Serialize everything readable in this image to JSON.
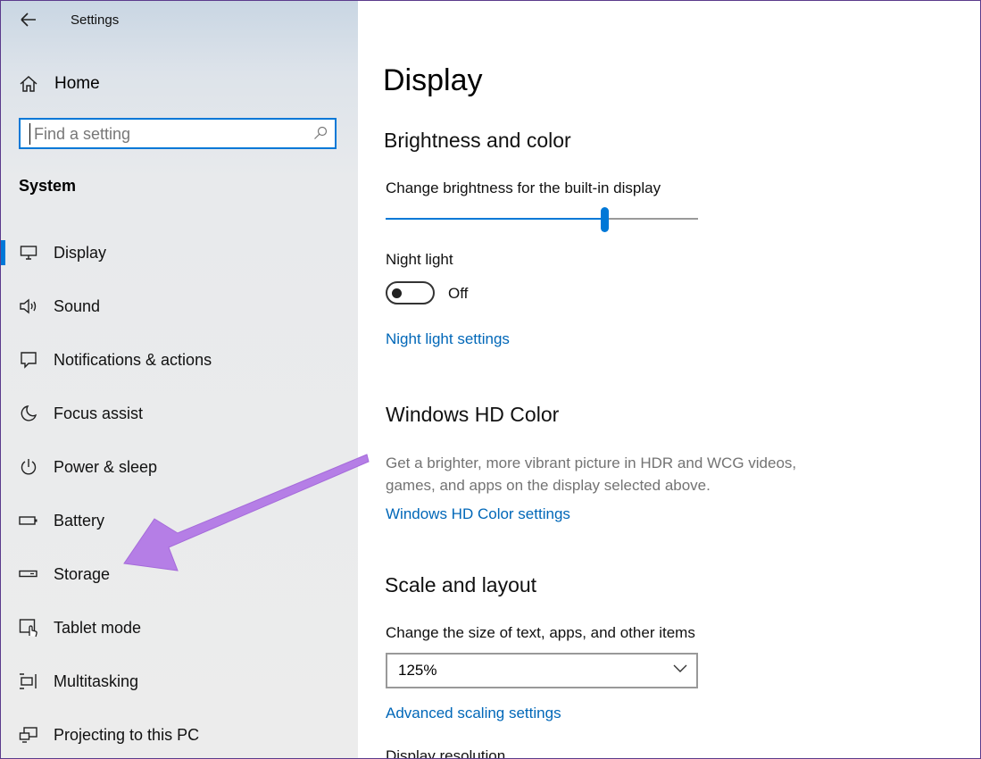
{
  "window": {
    "title": "Settings"
  },
  "sidebar": {
    "home_label": "Home",
    "search": {
      "placeholder": "Find a setting",
      "value": ""
    },
    "section_title": "System",
    "items": [
      {
        "label": "Display",
        "icon": "monitor-icon",
        "active": true
      },
      {
        "label": "Sound",
        "icon": "speaker-icon"
      },
      {
        "label": "Notifications & actions",
        "icon": "notification-icon"
      },
      {
        "label": "Focus assist",
        "icon": "moon-icon"
      },
      {
        "label": "Power & sleep",
        "icon": "power-icon"
      },
      {
        "label": "Battery",
        "icon": "battery-icon"
      },
      {
        "label": "Storage",
        "icon": "storage-icon"
      },
      {
        "label": "Tablet mode",
        "icon": "tablet-mode-icon"
      },
      {
        "label": "Multitasking",
        "icon": "multitasking-icon"
      },
      {
        "label": "Projecting to this PC",
        "icon": "projecting-icon"
      }
    ]
  },
  "main": {
    "title": "Display",
    "brightness_heading": "Brightness and color",
    "brightness_label": "Change brightness for the built-in display",
    "brightness_level": 0.7,
    "night_light_label": "Night light",
    "night_light_state": "Off",
    "night_light_link": "Night light settings",
    "hd_color_heading": "Windows HD Color",
    "hd_color_desc": "Get a brighter, more vibrant picture in HDR and WCG videos, games, and apps on the display selected above.",
    "hd_color_link": "Windows HD Color settings",
    "scale_heading": "Scale and layout",
    "scale_label": "Change the size of text, apps, and other items",
    "scale_value": "125%",
    "advanced_scaling_link": "Advanced scaling settings",
    "resolution_label": "Display resolution"
  },
  "annotation": {
    "color": "#b57ee6"
  },
  "colors": {
    "accent": "#0078d7",
    "link": "#0067b8"
  }
}
